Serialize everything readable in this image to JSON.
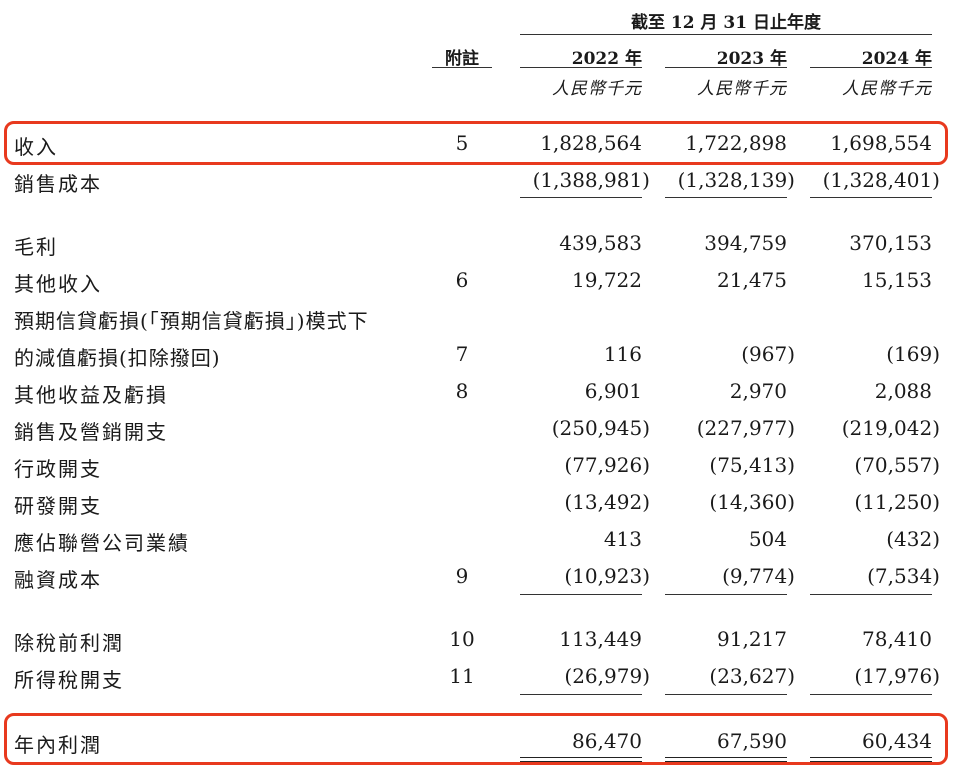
{
  "header": {
    "period": "截至 12 月 31 日止年度",
    "note_label": "附註",
    "years": [
      "2022 年",
      "2023 年",
      "2024 年"
    ],
    "unit": "人民幣千元"
  },
  "rows": [
    {
      "label": "收入",
      "note": "5",
      "values": [
        "1,828,564",
        "1,722,898",
        "1,698,554"
      ]
    },
    {
      "label": "銷售成本",
      "note": "",
      "values": [
        "(1,388,981)",
        "(1,328,139)",
        "(1,328,401)"
      ]
    },
    {
      "label": "毛利",
      "note": "",
      "values": [
        "439,583",
        "394,759",
        "370,153"
      ]
    },
    {
      "label": "其他收入",
      "note": "6",
      "values": [
        "19,722",
        "21,475",
        "15,153"
      ]
    },
    {
      "label": "預期信貸虧損(「預期信貸虧損」)模式下",
      "note": "",
      "values": [
        "",
        "",
        ""
      ]
    },
    {
      "label": "的減值虧損(扣除撥回)",
      "note": "7",
      "values": [
        "116",
        "(967)",
        "(169)"
      ]
    },
    {
      "label": "其他收益及虧損",
      "note": "8",
      "values": [
        "6,901",
        "2,970",
        "2,088"
      ]
    },
    {
      "label": "銷售及營銷開支",
      "note": "",
      "values": [
        "(250,945)",
        "(227,977)",
        "(219,042)"
      ]
    },
    {
      "label": "行政開支",
      "note": "",
      "values": [
        "(77,926)",
        "(75,413)",
        "(70,557)"
      ]
    },
    {
      "label": "研發開支",
      "note": "",
      "values": [
        "(13,492)",
        "(14,360)",
        "(11,250)"
      ]
    },
    {
      "label": "應佔聯營公司業績",
      "note": "",
      "values": [
        "413",
        "504",
        "(432)"
      ]
    },
    {
      "label": "融資成本",
      "note": "9",
      "values": [
        "(10,923)",
        "(9,774)",
        "(7,534)"
      ]
    },
    {
      "label": "除稅前利潤",
      "note": "10",
      "values": [
        "113,449",
        "91,217",
        "78,410"
      ]
    },
    {
      "label": "所得稅開支",
      "note": "11",
      "values": [
        "(26,979)",
        "(23,627)",
        "(17,976)"
      ]
    },
    {
      "label": "年內利潤",
      "note": "",
      "values": [
        "86,470",
        "67,590",
        "60,434"
      ]
    }
  ],
  "colors": {
    "highlight": "#e8391e"
  }
}
